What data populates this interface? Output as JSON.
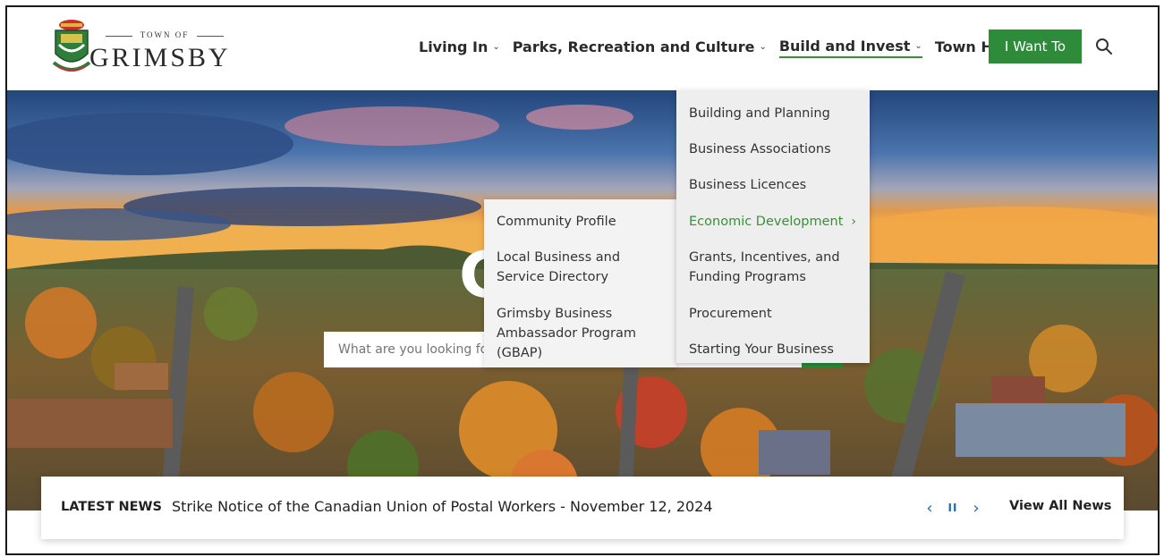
{
  "brand": {
    "town_of": "TOWN OF",
    "name": "GRIMSBY"
  },
  "nav": {
    "items": [
      {
        "label": "Living In"
      },
      {
        "label": "Parks, Recreation and Culture"
      },
      {
        "label": "Build and Invest",
        "active": true
      },
      {
        "label": "Town Hall"
      }
    ],
    "cta_label": "I Want To",
    "search_icon": "search-icon"
  },
  "hero": {
    "title_fragment": "C",
    "search_placeholder": "What are you looking fo"
  },
  "dropdown": {
    "items": [
      {
        "label": "Building and Planning"
      },
      {
        "label": "Business Associations"
      },
      {
        "label": "Business Licences"
      },
      {
        "label": "Economic Development",
        "active": true
      },
      {
        "label": "Grants, Incentives, and Funding Programs"
      },
      {
        "label": "Procurement"
      },
      {
        "label": "Starting Your Business"
      }
    ],
    "arrow": "›"
  },
  "submenu": {
    "items": [
      {
        "label": "Community Profile"
      },
      {
        "label": "Local Business and Service Directory"
      },
      {
        "label": "Grimsby Business Ambassador Program (GBAP)"
      }
    ]
  },
  "news": {
    "label": "LATEST NEWS",
    "headline": "Strike Notice of the Canadian Union of Postal Workers - November 12, 2024",
    "prev": "‹",
    "pause": "II",
    "next": "›",
    "view_all": "View All News"
  },
  "colors": {
    "accent_green": "#2e8b3a",
    "active_link": "#3a8f3a",
    "control_blue": "#1e6bb8"
  }
}
